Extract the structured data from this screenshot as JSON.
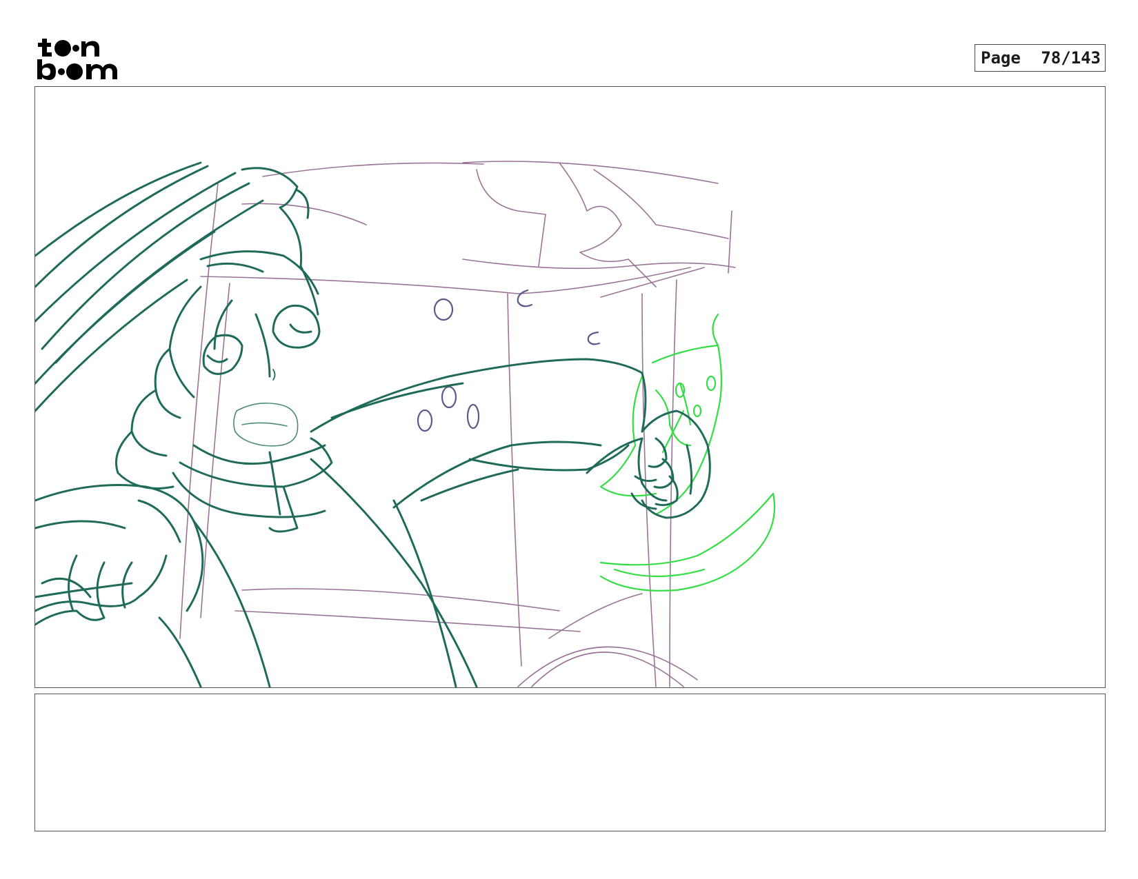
{
  "header": {
    "logo_name": "toon-boom-logo",
    "page_label": "Page",
    "page_number": "78/143"
  },
  "colors": {
    "character_line": "#1f6b58",
    "construction_line": "#8a5a86",
    "effect_line": "#33dd44",
    "bubble_line": "#5a5a8a"
  },
  "panel": {
    "notes": ""
  }
}
